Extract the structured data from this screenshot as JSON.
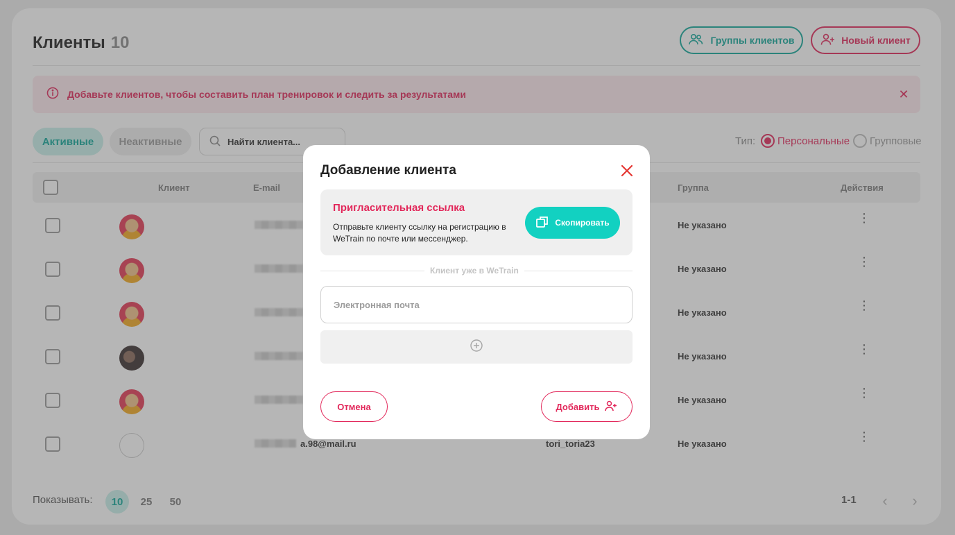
{
  "header": {
    "title": "Клиенты",
    "count": "10"
  },
  "toolbar": {
    "groups_label": "Группы клиентов",
    "new_client_label": "Новый клиент"
  },
  "alert": {
    "text": "Добавьте клиентов, чтобы составить план тренировок и следить за результатами"
  },
  "filters": {
    "active_tab": "Активные",
    "inactive_tab": "Неактивные",
    "search_placeholder": "Найти клиента...",
    "type_label": "Тип:",
    "type_personal": "Персональные",
    "type_group": "Групповые",
    "selected_type": "Персональные"
  },
  "table": {
    "columns": {
      "client": "Клиент",
      "email": "E-mail",
      "group": "Группа",
      "actions": "Действия"
    },
    "rows": [
      {
        "avatar": "red",
        "email": "",
        "login": "",
        "group": "Не указано"
      },
      {
        "avatar": "red",
        "email": "",
        "login": "",
        "group": "Не указано"
      },
      {
        "avatar": "red",
        "email": "",
        "login": "",
        "group": "Не указано"
      },
      {
        "avatar": "dark",
        "email": "",
        "login": "",
        "group": "Не указано"
      },
      {
        "avatar": "red",
        "email": "",
        "login": "",
        "group": "Не указано"
      },
      {
        "avatar": "broken",
        "email": "a.98@mail.ru",
        "login": "tori_toria23",
        "group": "Не указано"
      }
    ]
  },
  "pagination": {
    "show_label": "Показывать:",
    "sizes": [
      "10",
      "25",
      "50"
    ],
    "selected_size": "10",
    "range": "1-1"
  },
  "modal": {
    "title": "Добавление клиента",
    "invite_title": "Пригласительная ссылка",
    "invite_text": "Отправьте клиенту ссылку на регистрацию в WeTrain по почте или мессенджер.",
    "copy_label": "Скопировать",
    "separator_text": "Клиент уже в WeTrain",
    "email_placeholder": "Электронная почта",
    "cancel_label": "Отмена",
    "add_label": "Добавить"
  },
  "colors": {
    "accent_teal": "#11a89a",
    "accent_pink": "#e2275a",
    "copy_button": "#12d1c1"
  },
  "icons": {
    "groups": "people-icon",
    "new_client": "add-user-icon",
    "alert": "info-icon",
    "search": "search-icon",
    "copy": "copy-icon",
    "add_row": "plus-circle-icon",
    "add_button": "add-user-icon",
    "close": "close-icon",
    "more": "more-vertical-icon"
  }
}
